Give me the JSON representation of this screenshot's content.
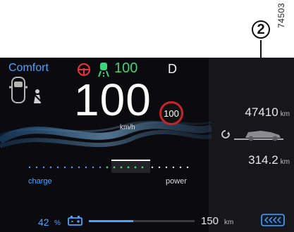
{
  "annotation": {
    "callout": "2",
    "reference_code": "74503"
  },
  "status_bar": {
    "drive_mode": "Comfort",
    "adas_speed": "100",
    "gear": "D"
  },
  "speedometer": {
    "speed": "100",
    "unit": "km/h",
    "speed_limit": "100"
  },
  "odometer": {
    "value": "47410",
    "unit": "km"
  },
  "trip": {
    "value": "314.2",
    "unit": "km"
  },
  "power_meter": {
    "charge_label": "charge",
    "power_label": "power"
  },
  "footer": {
    "battery_percent": "42",
    "battery_unit": "%",
    "range_value": "150",
    "range_unit": "km",
    "battery_level_fraction": 0.42
  },
  "icons": {
    "steering_warning": "steering-wheel-icon",
    "lane_assist": "lane-keep-icon",
    "vehicle": "car-top-icon",
    "seatbelt": "seatbelt-icon",
    "battery": "battery-icon",
    "trip": "trip-car-icon",
    "regen": "regen-icon"
  },
  "colors": {
    "accent_blue": "#4aa3ff",
    "adas_green": "#37d67a",
    "limit_red": "#c8252b",
    "warning_red": "#e0343a"
  }
}
